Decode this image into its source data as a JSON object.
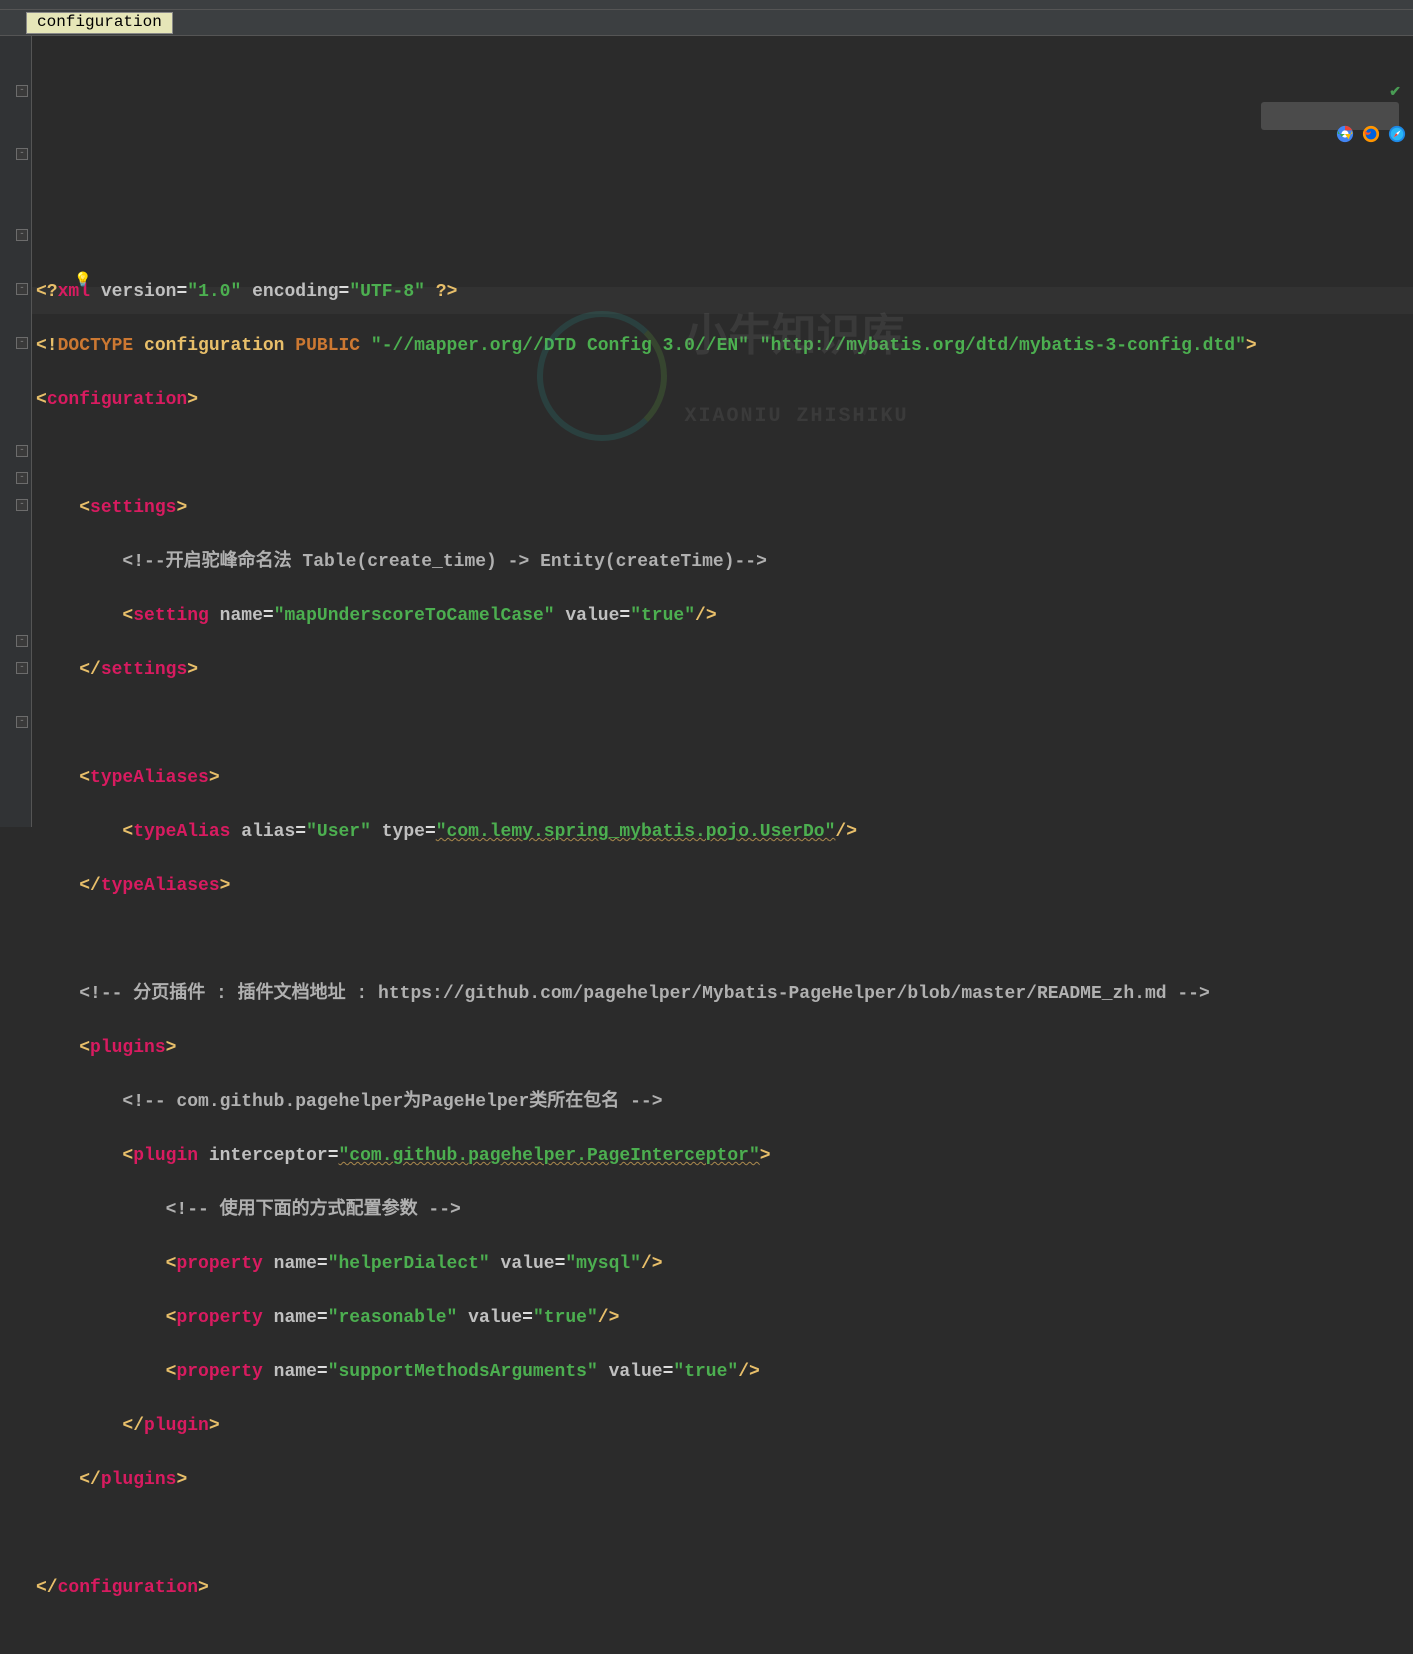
{
  "breadcrumb": {
    "current": "configuration"
  },
  "watermark": {
    "main": "小牛知识库",
    "sub": "XIAONIU ZHISHIKU"
  },
  "code": {
    "xmldecl": {
      "open": "<?",
      "name": "xml",
      "a1n": "version",
      "a1v": "\"1.0\"",
      "a2n": "encoding",
      "a2v": "\"UTF-8\"",
      "close": "?>"
    },
    "doctype": {
      "open": "<!",
      "kw": "DOCTYPE",
      "root": "configuration",
      "pub": "PUBLIC",
      "fpi": "\"-//mapper.org//DTD Config 3.0//EN\"",
      "uri": "\"http://mybatis.org/dtd/mybatis-3-config.dtd\"",
      "close": ">"
    },
    "cfg": {
      "open": "configuration",
      "close": "configuration"
    },
    "settings": {
      "tag": "settings",
      "comment": "<!--开启驼峰命名法 Table(create_time) -> Entity(createTime)-->",
      "setting": {
        "tag": "setting",
        "n": "name",
        "nv": "\"mapUnderscoreToCamelCase\"",
        "v": "value",
        "vv": "\"true\""
      }
    },
    "aliases": {
      "tag": "typeAliases",
      "alias": {
        "tag": "typeAlias",
        "a": "alias",
        "av": "\"User\"",
        "t": "type",
        "tv": "\"com.lemy.spring_mybatis.pojo.UserDo\""
      }
    },
    "pagecomment": "<!-- 分页插件 : 插件文档地址 : https://github.com/pagehelper/Mybatis-PageHelper/blob/master/README_zh.md -->",
    "plugins": {
      "tag": "plugins",
      "c1": "<!-- com.github.pagehelper为PageHelper类所在包名 -->",
      "plugin": {
        "tag": "plugin",
        "intn": "interceptor",
        "intv": "\"com.github.pagehelper.PageInterceptor\""
      },
      "c2": "<!-- 使用下面的方式配置参数 -->",
      "p1": {
        "tag": "property",
        "n": "name",
        "nv": "\"helperDialect\"",
        "v": "value",
        "vv": "\"mysql\""
      },
      "p2": {
        "tag": "property",
        "n": "name",
        "nv": "\"reasonable\"",
        "v": "value",
        "vv": "\"true\""
      },
      "p3": {
        "tag": "property",
        "n": "name",
        "nv": "\"supportMethodsArguments\"",
        "v": "value",
        "vv": "\"true\""
      }
    }
  },
  "folds": [
    85,
    148,
    283,
    445,
    472,
    499
  ],
  "foldsClose": [
    229,
    337,
    635,
    662,
    716
  ]
}
